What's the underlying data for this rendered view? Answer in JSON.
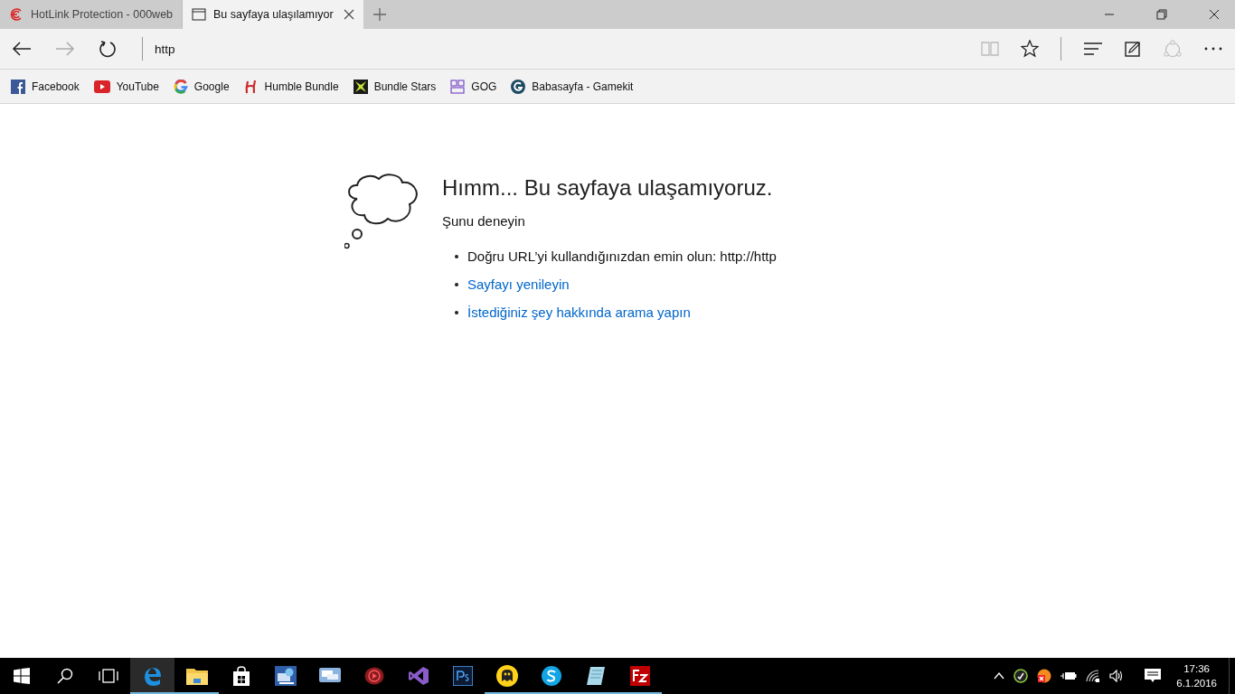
{
  "tabs": [
    {
      "title": "HotLink Protection - 000web",
      "kind": "site",
      "selected": false
    },
    {
      "title": "Bu sayfaya ulaşılamıyor",
      "kind": "page",
      "selected": true
    }
  ],
  "address_bar": {
    "value": "http"
  },
  "bookmarks": [
    {
      "label": "Facebook",
      "kind": "facebook"
    },
    {
      "label": "YouTube",
      "kind": "youtube"
    },
    {
      "label": "Google",
      "kind": "google"
    },
    {
      "label": "Humble Bundle",
      "kind": "humble"
    },
    {
      "label": "Bundle Stars",
      "kind": "stars"
    },
    {
      "label": "GOG",
      "kind": "gog"
    },
    {
      "label": "Babasayfa - Gamekit",
      "kind": "gamekit"
    }
  ],
  "error_page": {
    "title": "Hımm... Bu sayfaya ulaşamıyoruz.",
    "subtitle": "Şunu deneyin",
    "suggestions": [
      {
        "text": "Doğru URL’yi kullandığınızdan emin olun: http://http",
        "kind": "text"
      },
      {
        "text": "Sayfayı yenileyin",
        "kind": "link"
      },
      {
        "text": "İstediğiniz şey hakkında arama yapın",
        "kind": "link"
      }
    ]
  },
  "taskbar": {
    "apps": [
      {
        "kind": "edge",
        "selected": true,
        "running": true
      },
      {
        "kind": "folder",
        "selected": false,
        "running": true
      },
      {
        "kind": "store",
        "selected": false,
        "running": false
      },
      {
        "kind": "remote",
        "selected": false,
        "running": false
      },
      {
        "kind": "chat",
        "selected": false,
        "running": false
      },
      {
        "kind": "video",
        "selected": false,
        "running": false
      },
      {
        "kind": "vs",
        "selected": false,
        "running": false
      },
      {
        "kind": "ps",
        "selected": false,
        "running": false
      },
      {
        "kind": "ghost",
        "selected": false,
        "running": true
      },
      {
        "kind": "skype",
        "selected": false,
        "running": true
      },
      {
        "kind": "notepad",
        "selected": false,
        "running": true
      },
      {
        "kind": "filezilla",
        "selected": false,
        "running": true
      }
    ],
    "time": "17:36",
    "date": "6.1.2016"
  }
}
